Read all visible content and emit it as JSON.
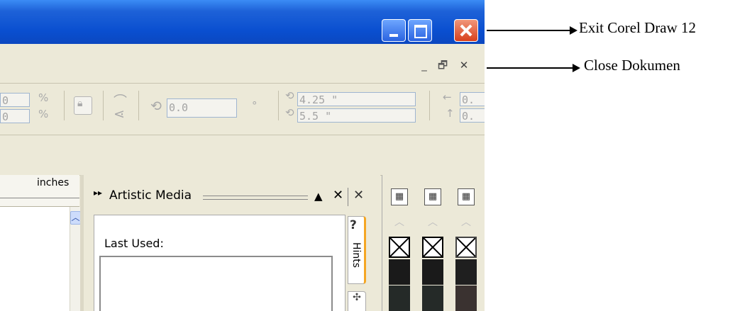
{
  "window_controls": {
    "minimize_icon": "minimize-icon",
    "maximize_icon": "maximize-icon",
    "close_icon": "close-icon"
  },
  "document_controls": {
    "minimize": "_",
    "restore": "🗗",
    "close": "✕"
  },
  "property_bar": {
    "scale_top_value": "0",
    "scale_bottom_value": "0",
    "percent_symbol": "%",
    "rotation_value": "0.0",
    "degree_symbol": "°",
    "pos_x_value": "4.25 \"",
    "pos_y_value": "5.5 \"",
    "offset_top_value": "0.",
    "offset_bottom_value": "0."
  },
  "ruler": {
    "unit_label": "inches"
  },
  "docker": {
    "expand_glyph": "▸▸",
    "title": "Artistic Media",
    "collapse_glyph": "▲",
    "close_glyph": "✕",
    "close_all_glyph": "✕",
    "last_used_label": "Last Used:",
    "tabs": [
      {
        "label": "Hints"
      }
    ]
  },
  "annotations": [
    {
      "text": "Exit Corel Draw 12"
    },
    {
      "text": "Close Dokumen"
    }
  ],
  "colors": {
    "titlebar_blue": "#0a4fd0",
    "close_red": "#d8401c",
    "chrome_beige": "#ece9d8",
    "hints_tab_accent": "#f5a623",
    "swatch_black": "#1a1a1a",
    "swatch_dark_gray_1": "#252a28",
    "swatch_dark_gray_2": "#3a3230"
  }
}
